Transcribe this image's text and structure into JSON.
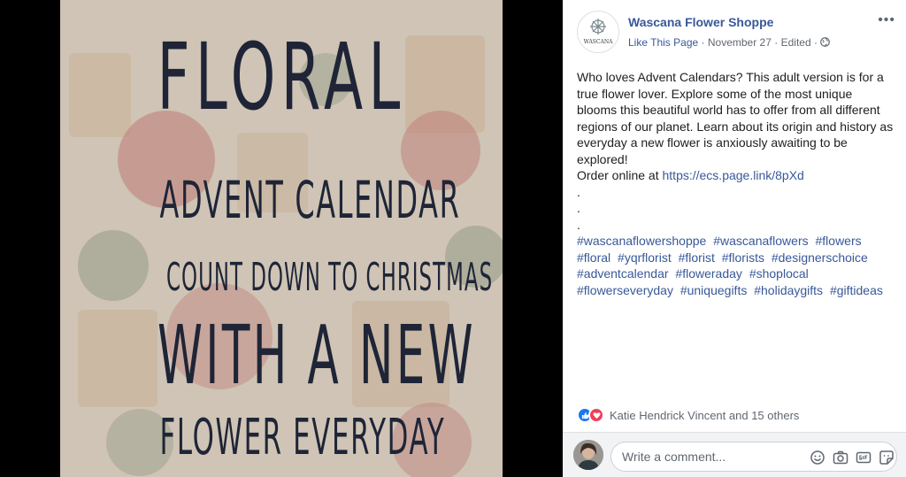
{
  "photo": {
    "lines": [
      "FLORAL",
      "ADVENT CALENDAR",
      "COUNT DOWN TO CHRISTMAS",
      "WITH A NEW",
      "FLOWER EVERYDAY"
    ]
  },
  "post": {
    "page_name": "Wascana Flower Shoppe",
    "avatar_text": "WASCANA",
    "like_page": "Like This Page",
    "date": "November 27",
    "edited": "Edited",
    "more": "•••",
    "body": "Who loves Advent Calendars? This adult version is for a true flower lover. Explore some of the most unique blooms this beautiful world has to offer from all different regions of our planet. Learn about its origin and history as everyday a new flower is anxiously awaiting to be explored!",
    "order_label": "Order online at",
    "order_link": "https://ecs.page.link/8pXd",
    "dots": [
      ".",
      ".",
      "."
    ],
    "hashtags": [
      "#wascanaflowershoppe",
      "#wascanaflowers",
      "#flowers",
      "#floral",
      "#yqrflorist",
      "#florist",
      "#florists",
      "#designerschoice",
      "#adventcalendar",
      "#floweraday",
      "#shoplocal",
      "#flowerseveryday",
      "#uniquegifts",
      "#holidaygifts",
      "#giftideas"
    ]
  },
  "reactions": {
    "text": "Katie Hendrick Vincent and 15 others",
    "icons": [
      "like-icon",
      "love-icon"
    ]
  },
  "comment": {
    "placeholder": "Write a comment...",
    "icons": [
      "emoji-icon",
      "camera-icon",
      "gif-icon",
      "sticker-icon"
    ]
  },
  "colors": {
    "link": "#385898",
    "text": "#1c1e21",
    "secondary": "#606770",
    "like": "#1877f2",
    "love": "#f33e58",
    "poster_text": "#1f2537"
  }
}
